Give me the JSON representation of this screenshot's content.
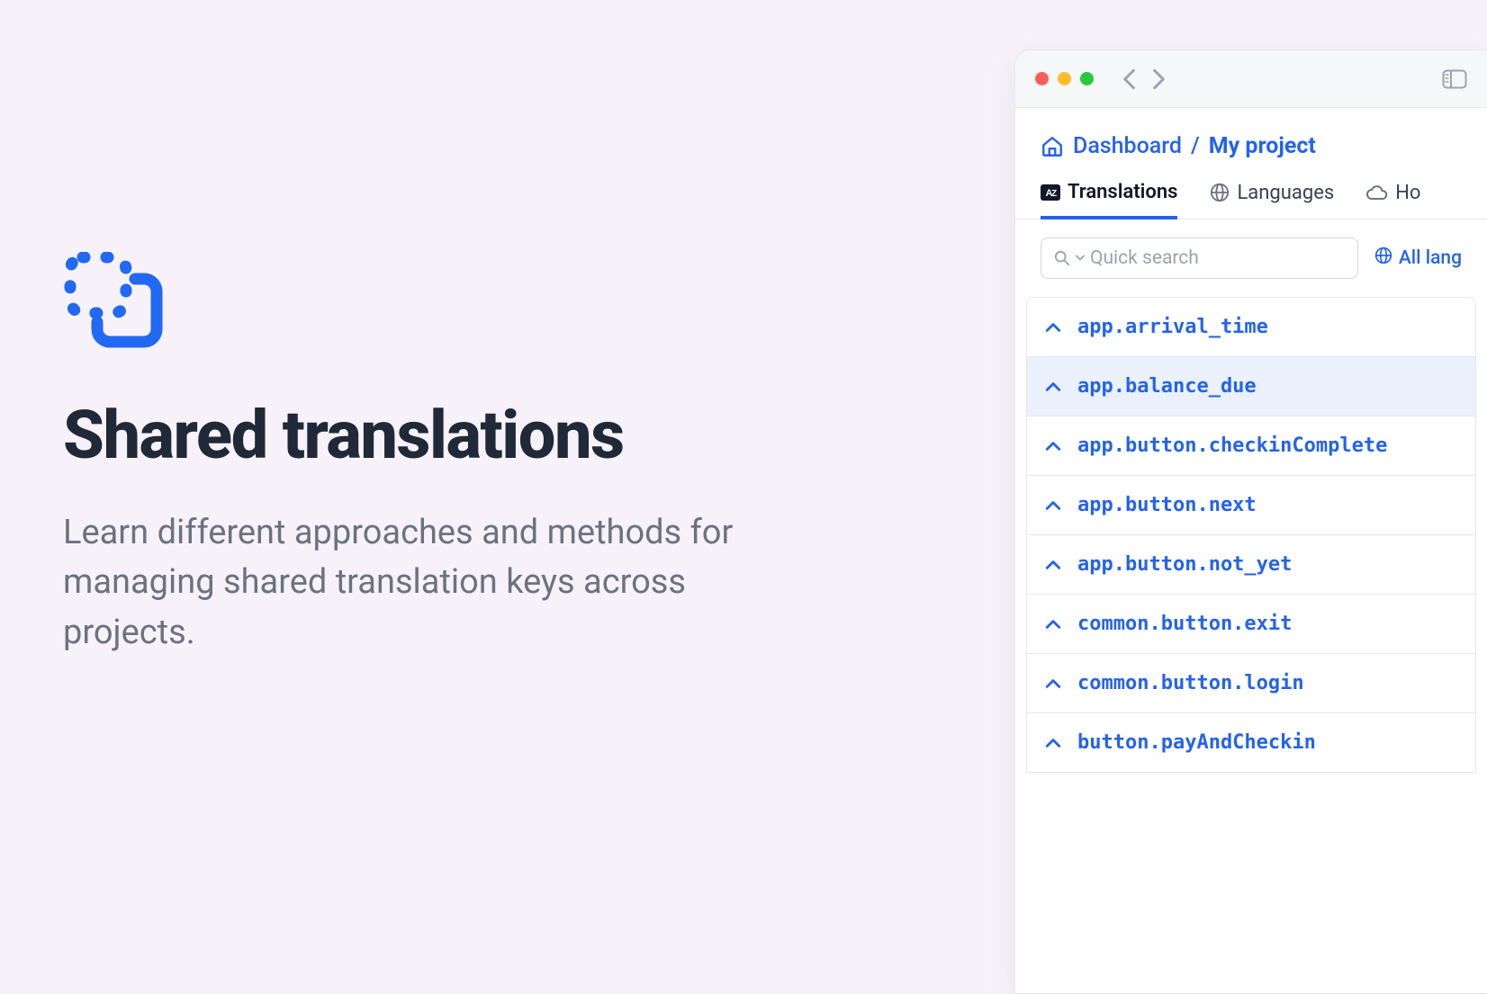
{
  "hero": {
    "title": "Shared translations",
    "subtitle": "Learn different approaches and methods for managing shared translation keys across projects."
  },
  "breadcrumb": {
    "root": "Dashboard",
    "separator": "/",
    "current": "My project"
  },
  "tabs": [
    {
      "label": "Translations",
      "active": true,
      "icon": "translations"
    },
    {
      "label": "Languages",
      "active": false,
      "icon": "globe"
    },
    {
      "label": "Ho",
      "active": false,
      "icon": "cloud"
    }
  ],
  "search": {
    "placeholder": "Quick search"
  },
  "lang_filter": {
    "label": "All lang"
  },
  "keys": [
    {
      "label": "app.arrival_time",
      "selected": false
    },
    {
      "label": "app.balance_due",
      "selected": true
    },
    {
      "label": "app.button.checkinComplete",
      "selected": false
    },
    {
      "label": "app.button.next",
      "selected": false
    },
    {
      "label": "app.button.not_yet",
      "selected": false
    },
    {
      "label": "common.button.exit",
      "selected": false
    },
    {
      "label": "common.button.login",
      "selected": false
    },
    {
      "label": "button.payAndCheckin",
      "selected": false
    }
  ]
}
